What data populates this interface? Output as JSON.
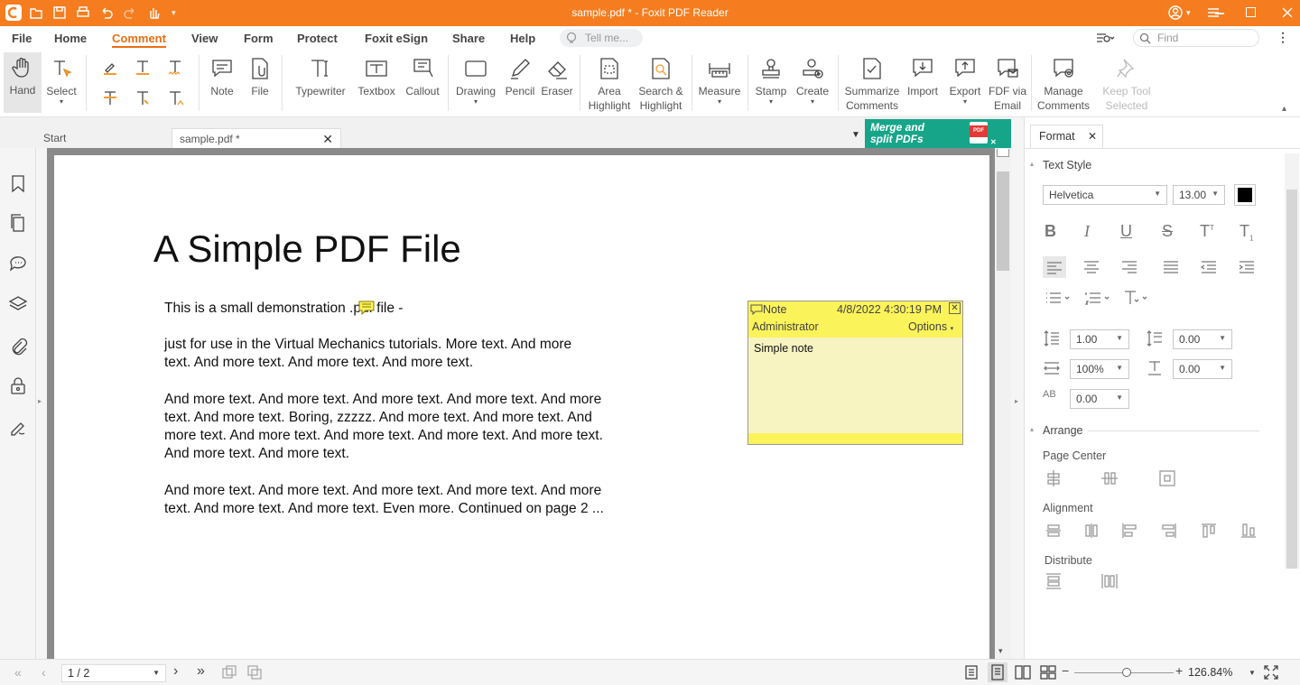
{
  "window": {
    "title": "sample.pdf * - Foxit PDF Reader"
  },
  "menu": [
    "File",
    "Home",
    "Comment",
    "View",
    "Form",
    "Protect",
    "Foxit eSign",
    "Share",
    "Help"
  ],
  "tell_me_placeholder": "Tell me...",
  "find_placeholder": "Find",
  "ribbon": {
    "hand": "Hand",
    "select": "Select",
    "note": "Note",
    "file": "File",
    "typewriter": "Typewriter",
    "textbox": "Textbox",
    "callout": "Callout",
    "drawing": "Drawing",
    "pencil": "Pencil",
    "eraser": "Eraser",
    "area_highlight_1": "Area",
    "area_highlight_2": "Highlight",
    "search_highlight_1": "Search &",
    "search_highlight_2": "Highlight",
    "measure": "Measure",
    "stamp": "Stamp",
    "create": "Create",
    "summarize_1": "Summarize",
    "summarize_2": "Comments",
    "import": "Import",
    "export": "Export",
    "fdf_1": "FDF via",
    "fdf_2": "Email",
    "manage_1": "Manage",
    "manage_2": "Comments",
    "keep_1": "Keep Tool",
    "keep_2": "Selected"
  },
  "tabs": {
    "start": "Start",
    "doc": "sample.pdf *"
  },
  "banner": {
    "line1": "Merge and",
    "line2": "split PDFs"
  },
  "document": {
    "title": "A Simple PDF File",
    "p1": "This is a small demonstration .pdf file -",
    "p2": [
      "just for use in the Virtual Mechanics tutorials. More text. And more",
      "text. And more text. And more text. And more text."
    ],
    "p3": [
      "And more text. And more text. And more text. And more text. And more",
      "text. And more text. Boring, zzzzz. And more text. And more text. And",
      "more text. And more text. And more text. And more text. And more text.",
      "And more text. And more text."
    ],
    "p4": [
      "And more text. And more text. And more text. And more text. And more",
      "text. And more text. And more text. Even more. Continued on page 2 ..."
    ]
  },
  "note": {
    "label": "Note",
    "date": "4/8/2022 4:30:19 PM",
    "author": "Administrator",
    "options": "Options",
    "content": "Simple note"
  },
  "format_panel": {
    "tab": "Format",
    "text_style": "Text Style",
    "font": "Helvetica",
    "font_size": "13.00",
    "font_color": "#000000",
    "line_spacing": "1.00",
    "para_spacing": "0.00",
    "h_scale": "100%",
    "baseline": "0.00",
    "char_spacing": "0.00",
    "arrange": "Arrange",
    "page_center": "Page Center",
    "alignment": "Alignment",
    "distribute": "Distribute"
  },
  "status": {
    "page": "1 / 2",
    "zoom": "126.84%"
  },
  "colors": {
    "titlebar": "#f57d1f",
    "accent": "#e86f14",
    "banner": "#17a589",
    "note_header": "#fbf35a",
    "note_body": "#f7f4c2"
  }
}
